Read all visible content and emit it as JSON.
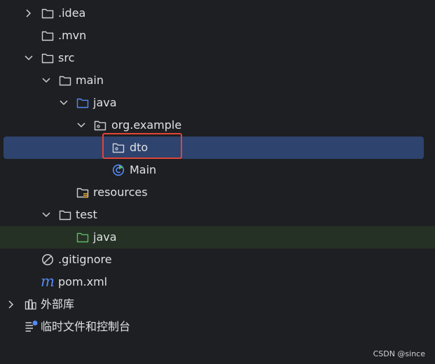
{
  "tree": {
    "idea": ".idea",
    "mvn": ".mvn",
    "src": "src",
    "main": "main",
    "java_main": "java",
    "org_example": "org.example",
    "dto": "dto",
    "main_class": "Main",
    "resources": "resources",
    "test": "test",
    "java_test": "java",
    "gitignore": ".gitignore",
    "pom": "pom.xml",
    "external_libs": "外部库",
    "scratches": "临时文件和控制台"
  },
  "watermark": "CSDN @since",
  "colors": {
    "background": "#1e1f22",
    "selection": "#2e436e",
    "test_row_background": "#253124",
    "folder_icon": "#ced0d6",
    "source_folder_icon": "#548af7",
    "test_folder_icon": "#5fb865",
    "highlight_box": "#e0453b"
  }
}
